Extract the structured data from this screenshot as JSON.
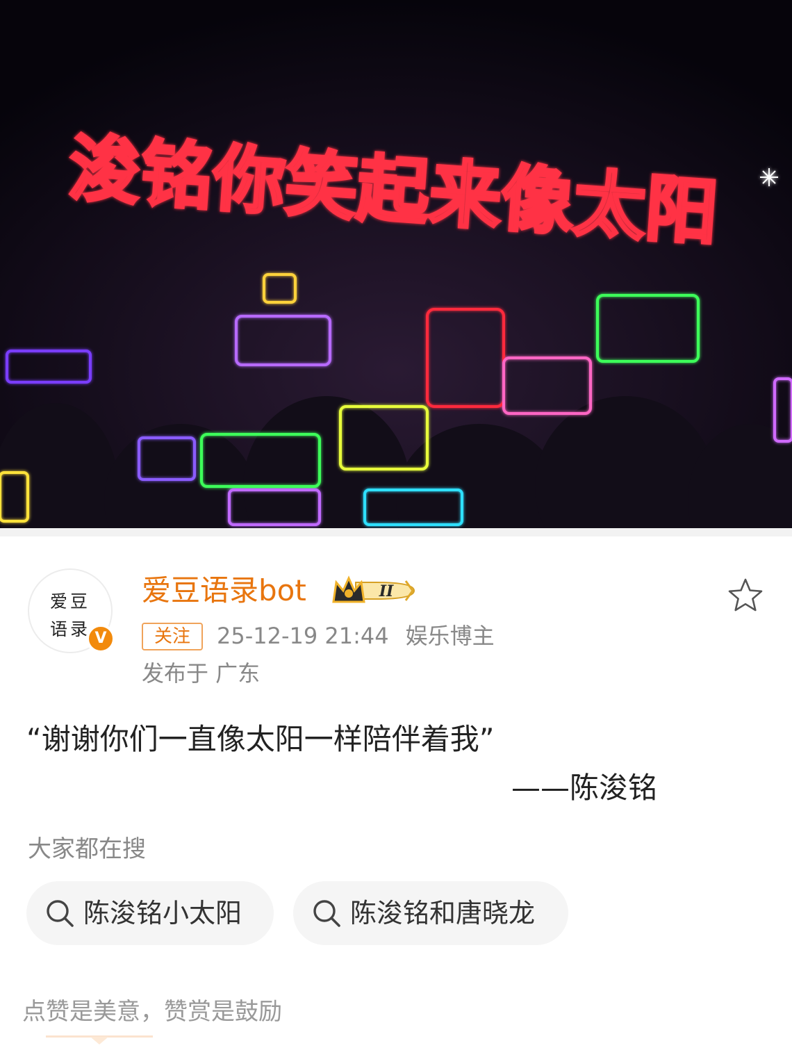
{
  "photo": {
    "banner_text": "浚铭你笑起来像太阳"
  },
  "post": {
    "avatar_text_line1": "爱豆",
    "avatar_text_line2": "语录",
    "verified_badge": "V",
    "username": "爱豆语录bot",
    "fan_level": "II",
    "follow_label": "关注",
    "timestamp": "25-12-19 21:44",
    "category": "娱乐博主",
    "location": "发布于 广东",
    "quote": "“谢谢你们一直像太阳一样陪伴着我”",
    "signature": "——陈浚铭"
  },
  "search": {
    "heading": "大家都在搜",
    "chips": [
      {
        "label": "陈浚铭小太阳",
        "icon": "search-icon"
      },
      {
        "label": "陈浚铭和唐晓龙",
        "icon": "search-icon"
      }
    ]
  },
  "reward": {
    "text": "点赞是美意，赞赏是鼓励"
  },
  "colors": {
    "accent_orange": "#e8750e",
    "verified": "#f28a0c",
    "chip_bg": "#f5f5f5",
    "neon_red": "#ff3344"
  },
  "icons": [
    "crown-icon",
    "star-icon",
    "search-icon",
    "verified-icon"
  ]
}
